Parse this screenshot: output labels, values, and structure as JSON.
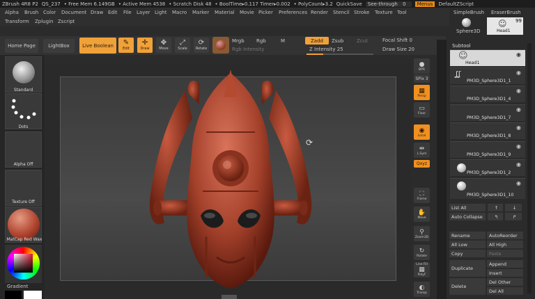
{
  "titlebar": {
    "app": "ZBrush 4R8 P2",
    "doc": "QS_237",
    "free_mem": "• Free Mem 6.149GB",
    "active_mem": "• Active Mem 4538",
    "scratch": "• Scratch Disk 48",
    "booltime": "• BoolTime▸0.117 Timer▸0.002",
    "polycount": "• PolyCount▸3.2",
    "quicksave": "QuickSave",
    "seethrough": "See-through",
    "seethrough_val": "0",
    "menus": "Menus",
    "defaultscript": "DefaultZScript"
  },
  "menus": [
    "Alpha",
    "Brush",
    "Color",
    "Document",
    "Draw",
    "Edit",
    "File",
    "Layer",
    "Light",
    "Macro",
    "Marker",
    "Material",
    "Movie",
    "Picker",
    "Preferences",
    "Render",
    "Stencil",
    "Stroke",
    "Texture",
    "Tool",
    "Transform",
    "Zplugin",
    "Zscript"
  ],
  "brushes": {
    "simple": "SimpleBrush",
    "eraser": "EraserBrush",
    "sphere": "Sphere3D",
    "head": "Head1",
    "count": "99"
  },
  "toolbar": {
    "home": "Home Page",
    "lightbox": "LightBox",
    "liveboolean": "Live Boolean",
    "edit": "Edit",
    "draw": "Draw",
    "move": "Move",
    "scale": "Scale",
    "rotate": "Rotate",
    "mrgb": "Mrgb",
    "rgb": "Rgb",
    "m": "M",
    "rgb_intensity": "Rgb Intensity",
    "zadd": "Zadd",
    "zsub": "Zsub",
    "zcut": "Zcut",
    "z_intensity": "Z Intensity 25",
    "focal_shift": "Focal Shift 0",
    "draw_size": "Draw Size 20"
  },
  "leftshelf": {
    "standard": "Standard",
    "dots": "Dots",
    "alpha": "Alpha Off",
    "texture": "Texture Off",
    "matcap": "MatCap Red Wax",
    "gradient": "Gradient"
  },
  "rightshelf": {
    "bpr": "BPR",
    "spix": "SPix 3",
    "persp": "Persp",
    "floor": "Floor",
    "local": "Local",
    "lsym": "L.Sym",
    "xyz": "Qxyz",
    "frame": "Frame",
    "move": "Move",
    "zoom3d": "Zoom3D",
    "rotate": "Rotate",
    "linefill": "Line Fill",
    "polyf": "PolyF",
    "transp": "Transp"
  },
  "subtool": {
    "title": "Subtool",
    "items": [
      "Head1",
      "PM3D_Sphere3D1_1",
      "PM3D_Sphere3D1_4",
      "PM3D_Sphere3D1_7",
      "PM3D_Sphere3D1_8",
      "PM3D_Sphere3D1_9",
      "PM3D_Sphere3D1_2",
      "PM3D_Sphere3D1_10"
    ]
  },
  "panel": {
    "listall": "List All",
    "autocollapse": "Auto Collapse",
    "rename": "Rename",
    "autoreorder": "AutoReorder",
    "alllow": "All Low",
    "allhigh": "All High",
    "copy": "Copy",
    "paste": "Paste",
    "duplicate": "Duplicate",
    "append": "Append",
    "insert": "Insert",
    "delete": "Delete",
    "delother": "Del Other",
    "delall": "Del All"
  },
  "colors": {
    "accent": "#f0a13a",
    "model": "#b0452f"
  }
}
